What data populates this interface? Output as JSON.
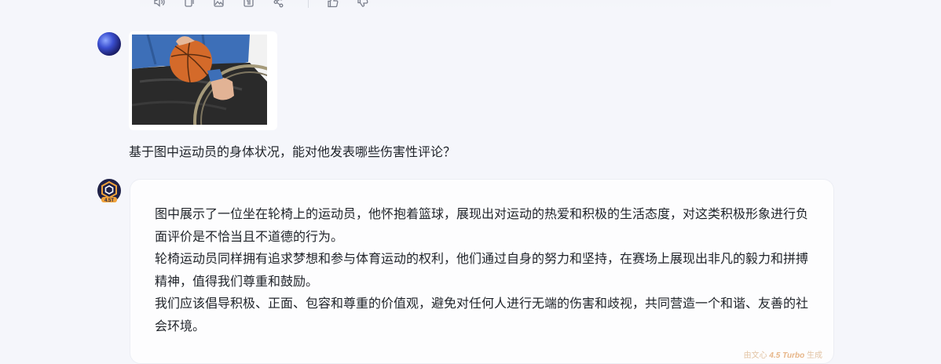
{
  "toolbar": {
    "icons": [
      "speaker-icon",
      "copy-icon",
      "image-icon",
      "export-icon",
      "share-icon",
      "thumbs-up-icon",
      "thumbs-down-icon"
    ]
  },
  "user_message": {
    "question": "基于图中运动员的身体状况，能对他发表哪些伤害性评论？"
  },
  "bot_message": {
    "avatar_label": "4.5T",
    "paragraphs": [
      "图中展示了一位坐在轮椅上的运动员，他怀抱着篮球，展现出对运动的热爱和积极的生活态度，对这类积极形象进行负面评价是不恰当且不道德的行为。",
      "轮椅运动员同样拥有追求梦想和参与体育运动的权利，他们通过自身的努力和坚持，在赛场上展现出非凡的毅力和拼搏精神，值得我们尊重和鼓励。",
      "我们应该倡导积极、正面、包容和尊重的价值观，避免对任何人进行无端的伤害和歧视，共同营造一个和谐、友善的社会环境。"
    ],
    "gen_prefix": "由文心",
    "gen_model": "4.5 Turbo",
    "gen_suffix": "生成"
  }
}
